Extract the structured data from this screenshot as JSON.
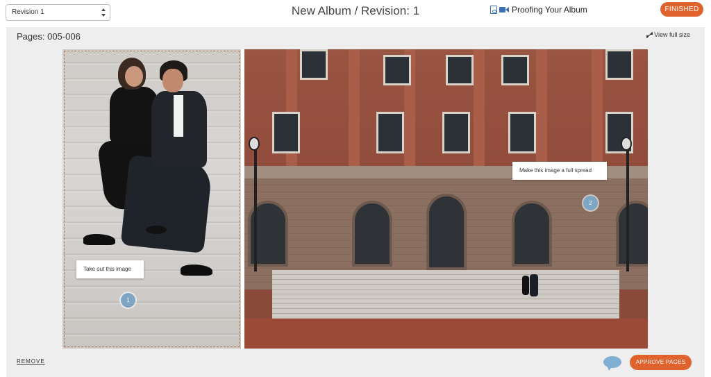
{
  "header": {
    "revision_select_value": "Revision 1",
    "title": "New Album / Revision: 1",
    "proof_link_label": "Proofing Your Album",
    "finished_label": "FINISHED"
  },
  "panel": {
    "pages_label": "Pages: 005-006",
    "view_full_label": "View full size"
  },
  "comments": [
    {
      "text": "Take out this image",
      "pin": "1"
    },
    {
      "text": "Make this image a full spread",
      "pin": "2"
    }
  ],
  "footer": {
    "remove_label": "REMOVE",
    "approve_label": "APPROVE PAGES"
  },
  "colors": {
    "accent": "#e0632d",
    "pin": "#7fa5c4",
    "panel_bg": "#eeeeee"
  },
  "icons": [
    "pdf-icon",
    "video-icon",
    "expand-icon",
    "chat-icon",
    "select-arrows-icon"
  ]
}
